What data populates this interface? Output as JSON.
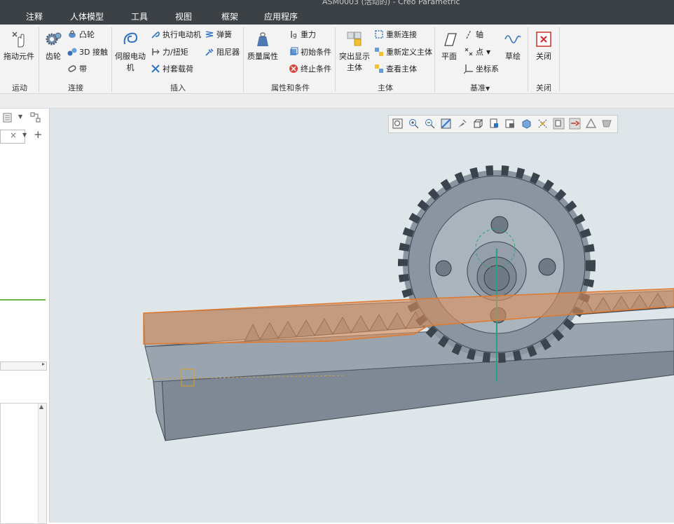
{
  "window": {
    "title": "ASM0003 (活动的) - Creo Parametric"
  },
  "menu": [
    "注释",
    "人体模型",
    "工具",
    "视图",
    "框架",
    "应用程序"
  ],
  "ribbon": {
    "motion": {
      "group": "运动",
      "drag": "拖动元件"
    },
    "connect": {
      "group": "连接",
      "gear": "齿轮",
      "cam": "凸轮",
      "contact3d": "3D 接触",
      "belt": "带"
    },
    "insert": {
      "group": "插入",
      "servo": "伺服电动机",
      "actuator": "执行电动机",
      "force": "力/扭矩",
      "bushing": "衬套载荷",
      "spring": "弹簧",
      "damper": "阻尼器"
    },
    "props": {
      "group": "属性和条件",
      "mass": "质量属性",
      "gravity": "重力",
      "init": "初始条件",
      "term": "终止条件"
    },
    "body": {
      "group": "主体",
      "highlight": "突出显示主体",
      "redefine": "重新连接",
      "redefine_body": "重新定义主体",
      "view_body": "查看主体"
    },
    "datum": {
      "group": "基准",
      "plane": "平面",
      "axis": "轴",
      "point": "点",
      "csys": "坐标系",
      "sketch": "草绘"
    },
    "close": {
      "group": "关闭",
      "label": "关闭"
    }
  },
  "left": {
    "search_close": "×",
    "add": "+"
  },
  "view_toolbar": [
    "zoom-fit-icon",
    "zoom-in-icon",
    "zoom-out-icon",
    "repaint-icon",
    "spin-center-icon",
    "display-style-icon",
    "saved-views-icon",
    "perspective-icon",
    "appearance-icon",
    "datum-display-icon",
    "annotation-icon",
    "sketch-display-icon",
    "glyph-icon",
    "settings-icon"
  ],
  "colors": {
    "menubar": "#3c4146",
    "ribbon": "#f3f3f3",
    "viewport": "#dfe6ea",
    "part_fill": "#8e98a3",
    "highlight": "#e07a2f"
  }
}
